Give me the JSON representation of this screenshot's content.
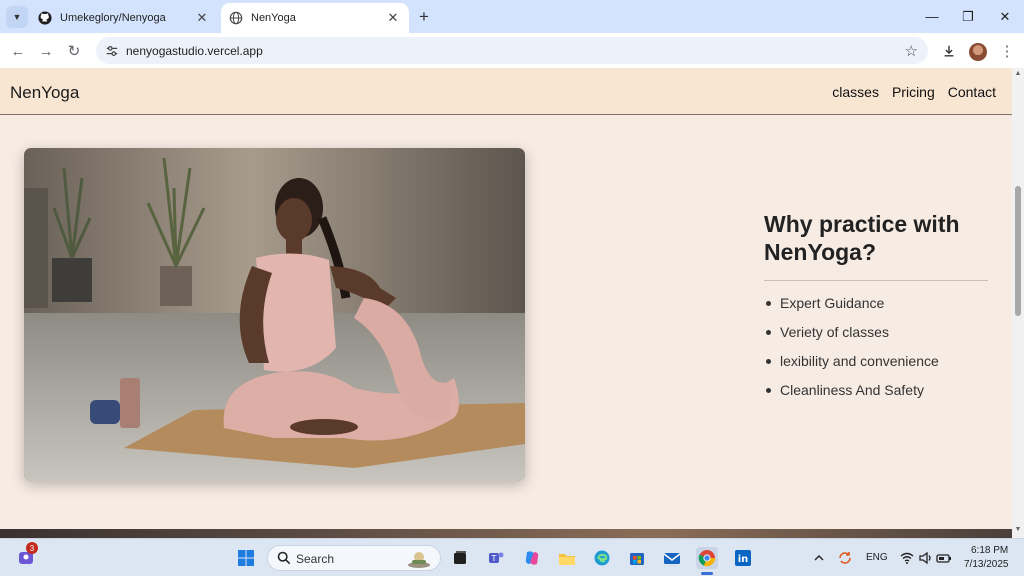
{
  "browser": {
    "tabs": [
      {
        "title": "Umekeglory/Nenyoga",
        "active": false
      },
      {
        "title": "NenYoga",
        "active": true
      }
    ],
    "url": "nenyogastudio.vercel.app"
  },
  "site": {
    "brand": "NenYoga",
    "nav": [
      "classes",
      "Pricing",
      "Contact"
    ],
    "why_heading": "Why practice with NenYoga?",
    "why_items": [
      "Expert Guidance",
      "Veriety of classes",
      "lexibility and convenience",
      "Cleanliness And Safety"
    ]
  },
  "taskbar": {
    "search_label": "Search",
    "badge_count": "3",
    "lang": "ENG",
    "time": "6:18 PM",
    "date": "7/13/2025"
  },
  "colors": {
    "header_bg": "#f8e5d2",
    "page_bg": "#f7ece4",
    "tab_strip": "#d3e3fd"
  }
}
